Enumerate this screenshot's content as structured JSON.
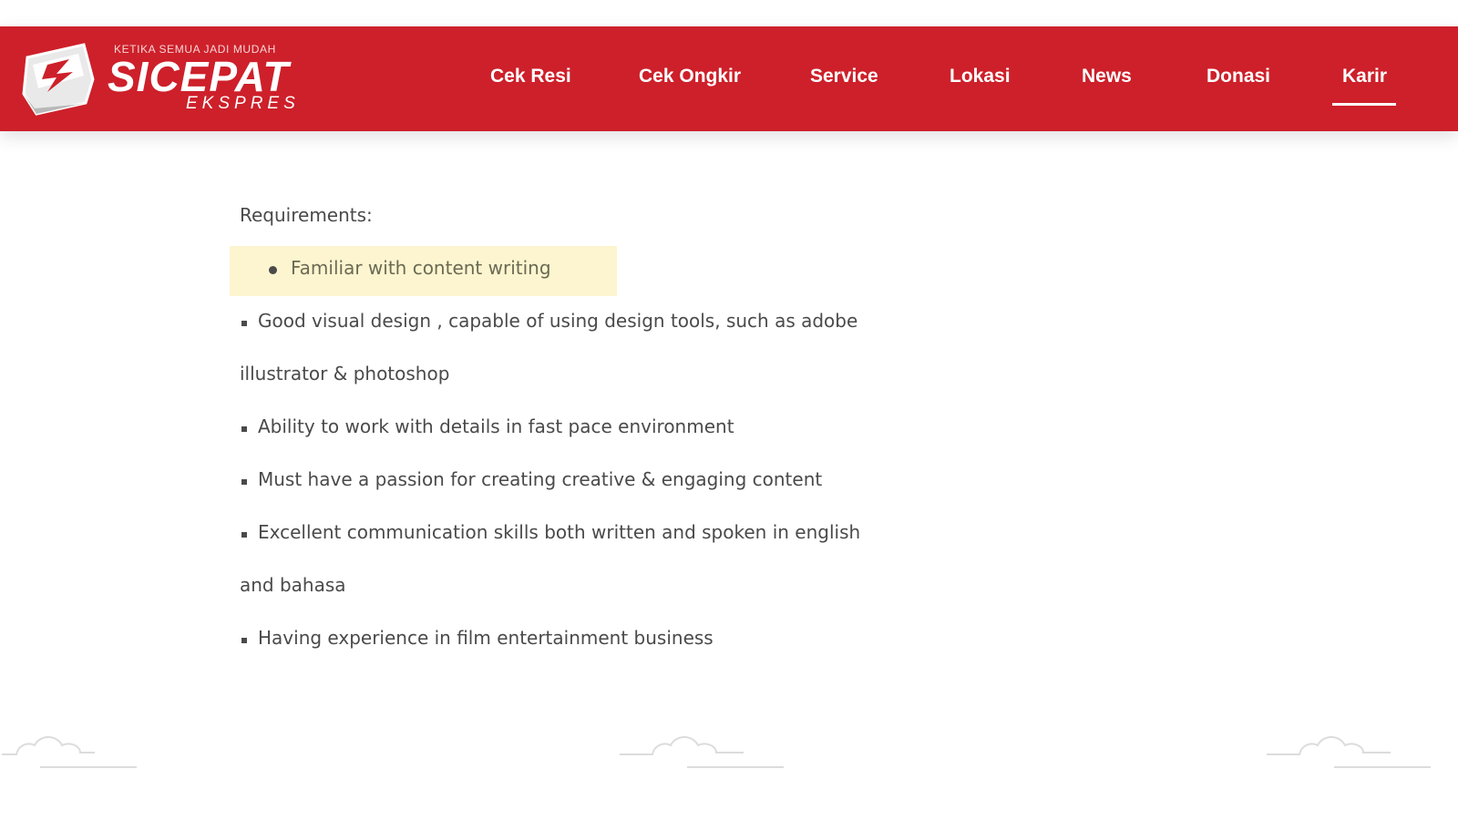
{
  "header": {
    "background_color": "#cd202a",
    "logo": {
      "tagline": "KETIKA SEMUA JADI MUDAH",
      "name": "SICEPAT",
      "sub": "EKSPRES"
    },
    "nav": [
      {
        "label": "Cek Resi",
        "active": false
      },
      {
        "label": "Cek Ongkir",
        "active": false
      },
      {
        "label": "Service",
        "active": false
      },
      {
        "label": "Lokasi",
        "active": false
      },
      {
        "label": "News",
        "active": false
      },
      {
        "label": "Donasi",
        "active": false
      },
      {
        "label": "Karir",
        "active": true
      }
    ]
  },
  "main": {
    "heading": "Requirements:",
    "highlighted_item": "Familiar with content writing",
    "highlight_color": "#fdf5cf",
    "items": [
      {
        "line1": "Good visual design , capable of using design tools, such as adobe",
        "line2": "illustrator & photoshop"
      },
      {
        "line1": "Ability to work with details in fast pace environment"
      },
      {
        "line1": "Must have a passion for creating creative & engaging content"
      },
      {
        "line1": "Excellent communication skills both written and spoken in english",
        "line2": "and bahasa"
      },
      {
        "line1": "Having experience in film entertainment business"
      }
    ]
  },
  "footer": {
    "decorations": [
      "cloud-icon",
      "cloud-icon",
      "cloud-icon"
    ]
  }
}
